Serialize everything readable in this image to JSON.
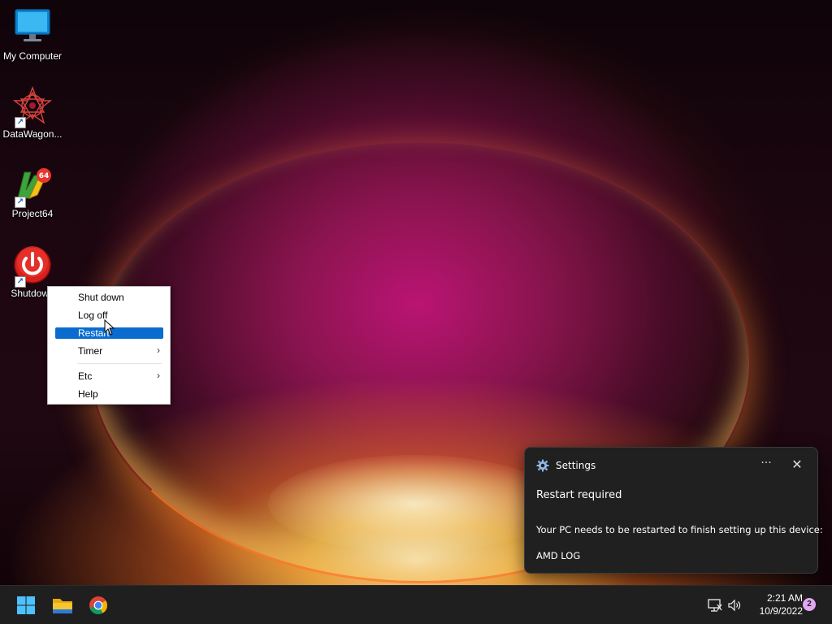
{
  "desktop": {
    "icons": [
      {
        "label": "My Computer",
        "icon": "monitor-icon"
      },
      {
        "label": "DataWagon...",
        "icon": "datawagon-icon"
      },
      {
        "label": "Project64",
        "icon": "project64-icon"
      },
      {
        "label": "Shutdown",
        "icon": "power-icon"
      }
    ]
  },
  "context_menu": {
    "items": [
      {
        "label": "Shut down",
        "submenu": false
      },
      {
        "label": "Log off",
        "submenu": false
      },
      {
        "label": "Restart",
        "submenu": false,
        "highlighted": true
      },
      {
        "label": "Timer",
        "submenu": true
      },
      {
        "label": "Etc",
        "submenu": true
      },
      {
        "label": "Help",
        "submenu": false
      }
    ],
    "submenu_glyph": "›"
  },
  "toast": {
    "app_name": "Settings",
    "more_glyph": "···",
    "close_glyph": "✕",
    "title": "Restart required",
    "body": "Your PC needs to be restarted to finish setting up this device:",
    "device": "AMD LOG"
  },
  "taskbar": {
    "pinned": [
      "start-icon",
      "file-explorer-icon",
      "chrome-icon"
    ],
    "clock_time": "2:21 AM",
    "clock_date": "10/9/2022",
    "notification_count": "2"
  },
  "colors": {
    "highlight": "#0a6ccf",
    "taskbar": "#1f1f1f",
    "toast_bg": "#202020",
    "badge": "#e2a6f2"
  }
}
